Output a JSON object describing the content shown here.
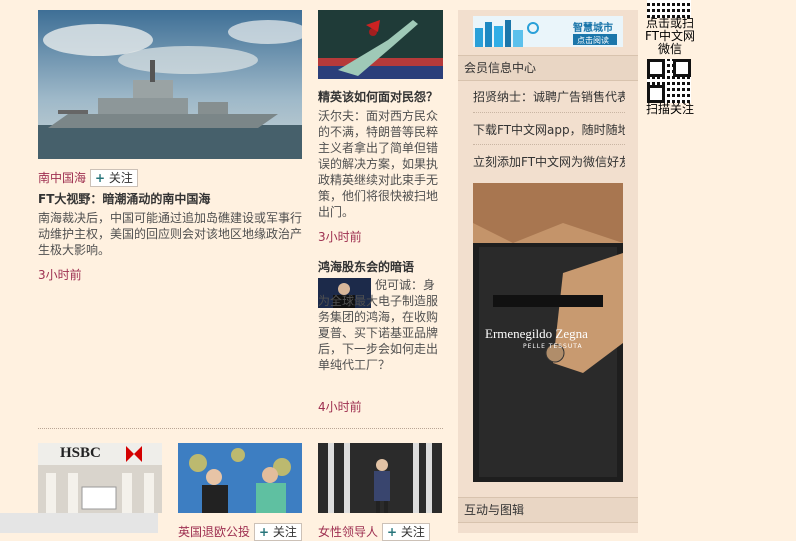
{
  "story_main": {
    "tag": "南中国海",
    "follow_label": "关注",
    "headline": "FT大视野：暗潮涌动的南中国海",
    "lead": "南海裁决后，中国可能通过追加岛礁建设或军事行动维护主权，美国的回应则会对该地区地缘政治产生极大影响。",
    "time": "3小时前"
  },
  "story_2": {
    "headline": "精英该如何面对民怨？",
    "lead": "沃尔夫：面对西方民众的不满，特朗普等民粹主义者拿出了简单但错误的解决方案，如果执政精英继续对此束手无策，他们将很快被扫地出门。",
    "time": "3小时前"
  },
  "story_3": {
    "headline": "鸿海股东会的暗语",
    "lead": "倪可诚：身为全球最大电子制造服务集团的鸿海，在收购夏普、买下诺基亚品牌后，下一步会如何走出单纯代工厂？",
    "time": "4小时前"
  },
  "bottom_row": {
    "items": [
      {
        "image_text": "HSBC",
        "tag": "",
        "follow_label": ""
      },
      {
        "image_text": "",
        "tag": "英国退欧公投",
        "follow_label": "关注"
      },
      {
        "image_text": "",
        "tag": "女性领导人",
        "follow_label": "关注"
      }
    ]
  },
  "rail": {
    "banner_text": "智慧城市",
    "banner_button": "点击阅读",
    "member_title": "会员信息中心",
    "member_items": [
      "招贤纳士：诚聘广告销售代表",
      "下载FT中文网app，随时随地",
      "立刻添加FT中文网为微信好友"
    ],
    "ad_brand": "Ermenegildo Zegna",
    "ad_sub": "PELLE TESSUTA",
    "interactive_title": "互动与图辑"
  },
  "qr": {
    "top_text": [
      "点击或扫",
      "FT中文网",
      "微信"
    ],
    "bottom_text": "扫描关注"
  }
}
